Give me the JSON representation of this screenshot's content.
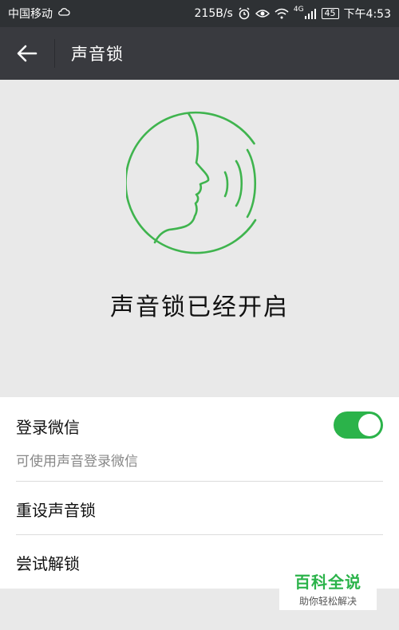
{
  "status_bar": {
    "carrier": "中国移动",
    "network_speed": "215B/s",
    "network_type": "4G",
    "battery": "45",
    "time": "下午4:53",
    "icons": [
      "cloud-icon",
      "alarm-icon",
      "eye-icon",
      "wifi-icon",
      "signal-icon",
      "battery-icon"
    ]
  },
  "title_bar": {
    "back_icon": "arrow-left-icon",
    "title": "声音锁"
  },
  "hero": {
    "icon": "voice-profile-icon",
    "status_text": "声音锁已经开启",
    "accent": "#3fb44e"
  },
  "settings": {
    "login": {
      "label": "登录微信",
      "sublabel": "可使用声音登录微信",
      "enabled": true
    },
    "reset_label": "重设声音锁",
    "try_label": "尝试解锁",
    "toggle_color": "#2bb34a"
  },
  "watermark": {
    "title": "百科全说",
    "subtitle": "助你轻松解决"
  }
}
